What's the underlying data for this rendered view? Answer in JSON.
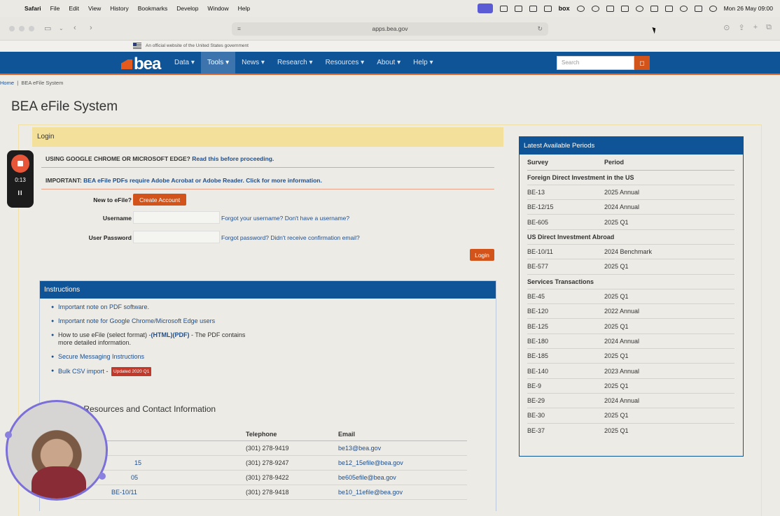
{
  "menubar": {
    "app": "Safari",
    "items": [
      "File",
      "Edit",
      "View",
      "History",
      "Bookmarks",
      "Develop",
      "Window",
      "Help"
    ],
    "box_label": "box",
    "datetime": "Mon 26 May  09:00"
  },
  "browser": {
    "url": "apps.bea.gov"
  },
  "gov_banner": "An official website of the United States government",
  "site": {
    "logo": "bea",
    "nav": [
      "Data",
      "Tools",
      "News",
      "Research",
      "Resources",
      "About",
      "Help"
    ],
    "active_nav": "Tools",
    "search_placeholder": "Search"
  },
  "breadcrumb": {
    "home": "Home",
    "current": "BEA eFile System"
  },
  "page_title": "BEA eFile System",
  "login": {
    "header": "Login",
    "notice1_text": "USING GOOGLE CHROME OR MICROSOFT EDGE?",
    "notice1_link": "Read this before proceeding.",
    "notice2_text": "IMPORTANT:",
    "notice2_link": "BEA eFile PDFs require Adobe Acrobat or Adobe Reader. Click for more information.",
    "new_label": "New to eFile?",
    "create_button": "Create Account",
    "username_label": "Username",
    "username_link": "Forgot your username? Don't have a username?",
    "password_label": "User Password",
    "password_link": "Forgot password? Didn't receive confirmation email?",
    "login_button": "Login"
  },
  "instructions": {
    "header": "Instructions",
    "item1": "Important note on PDF software.",
    "item2": "Important note for Google Chrome/Microsoft Edge users",
    "item3_pre": "How to use eFile (select format) -",
    "item3_html": "(HTML)",
    "item3_pdf": "(PDF)",
    "item3_post": " - The PDF contains more detailed information.",
    "item4": "Secure Messaging Instructions",
    "item5": "Bulk CSV import",
    "item5_sep": " - ",
    "item5_badge": "Updated 2020 Q1",
    "resources_title": "r Resources and Contact Information",
    "table_headers": [
      "Telephone",
      "Email"
    ],
    "rows": [
      {
        "survey": "",
        "phone": "(301) 278-9419",
        "email": "be13@bea.gov"
      },
      {
        "survey": "15",
        "phone": "(301) 278-9247",
        "email": "be12_15efile@bea.gov"
      },
      {
        "survey": "05",
        "phone": "(301) 278-9422",
        "email": "be605efile@bea.gov"
      },
      {
        "survey": "BE-10/11",
        "phone": "(301) 278-9418",
        "email": "be10_11efile@bea.gov"
      }
    ]
  },
  "periods": {
    "header": "Latest Available Periods",
    "col_survey": "Survey",
    "col_period": "Period",
    "groups": [
      {
        "name": "Foreign Direct Investment in the US",
        "rows": [
          {
            "survey": "BE-13",
            "period": "2025 Annual"
          },
          {
            "survey": "BE-12/15",
            "period": "2024 Annual"
          },
          {
            "survey": "BE-605",
            "period": "2025 Q1"
          }
        ]
      },
      {
        "name": "US Direct Investment Abroad",
        "rows": [
          {
            "survey": "BE-10/11",
            "period": "2024 Benchmark"
          },
          {
            "survey": "BE-577",
            "period": "2025 Q1"
          }
        ]
      },
      {
        "name": "Services Transactions",
        "rows": [
          {
            "survey": "BE-45",
            "period": "2025 Q1"
          },
          {
            "survey": "BE-120",
            "period": "2022 Annual"
          },
          {
            "survey": "BE-125",
            "period": "2025 Q1"
          },
          {
            "survey": "BE-180",
            "period": "2024 Annual"
          },
          {
            "survey": "BE-185",
            "period": "2025 Q1"
          },
          {
            "survey": "BE-140",
            "period": "2023 Annual"
          },
          {
            "survey": "BE-9",
            "period": "2025 Q1"
          },
          {
            "survey": "BE-29",
            "period": "2024 Annual"
          },
          {
            "survey": "BE-30",
            "period": "2025 Q1"
          },
          {
            "survey": "BE-37",
            "period": "2025 Q1"
          }
        ]
      }
    ]
  },
  "recorder": {
    "time": "0:13",
    "pause_glyph": "II"
  }
}
